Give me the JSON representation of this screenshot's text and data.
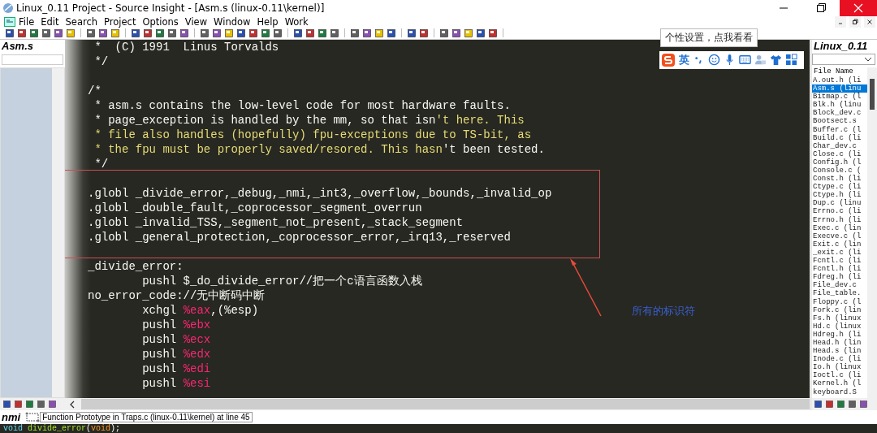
{
  "window": {
    "title": "Linux_0.11 Project - Source Insight - [Asm.s (linux-0.11\\kernel)]"
  },
  "menu": [
    "File",
    "Edit",
    "Search",
    "Project",
    "Options",
    "View",
    "Window",
    "Help",
    "Work"
  ],
  "left_panel": {
    "title": "Asm.s"
  },
  "code": [
    {
      "kind": "code",
      "segments": [
        {
          "kind": "plain",
          "text": " *  (C) 1991  Linus Torvalds"
        }
      ]
    },
    {
      "kind": "code",
      "segments": [
        {
          "kind": "plain",
          "text": " */"
        }
      ]
    },
    {
      "kind": "blank"
    },
    {
      "kind": "code",
      "segments": [
        {
          "kind": "plain",
          "text": "/*"
        }
      ]
    },
    {
      "kind": "code",
      "segments": [
        {
          "kind": "plain",
          "text": " * asm.s contains the low-level code for most hardware faults."
        }
      ]
    },
    {
      "kind": "code",
      "segments": [
        {
          "kind": "plain",
          "text": " * page_exception is handled by the mm, so that isn"
        },
        {
          "kind": "string",
          "text": "'t here. This"
        }
      ]
    },
    {
      "kind": "code",
      "segments": [
        {
          "kind": "string",
          "text": " * file also handles (hopefully) fpu-exceptions due to TS-bit, as"
        }
      ]
    },
    {
      "kind": "code",
      "segments": [
        {
          "kind": "string",
          "text": " * the fpu must be properly saved/resored. This hasn"
        },
        {
          "kind": "plain",
          "text": "'t been tested."
        }
      ]
    },
    {
      "kind": "code",
      "segments": [
        {
          "kind": "plain",
          "text": " */"
        }
      ]
    },
    {
      "kind": "blank"
    },
    {
      "kind": "code",
      "segments": [
        {
          "kind": "plain",
          "text": ".globl _divide_error,_debug,_nmi,_int3,_overflow,_bounds,_invalid_op"
        }
      ]
    },
    {
      "kind": "code",
      "segments": [
        {
          "kind": "plain",
          "text": ".globl _double_fault,_coprocessor_segment_overrun"
        }
      ]
    },
    {
      "kind": "code",
      "segments": [
        {
          "kind": "plain",
          "text": ".globl _invalid_TSS,_segment_not_present,_stack_segment"
        }
      ]
    },
    {
      "kind": "code",
      "segments": [
        {
          "kind": "plain",
          "text": ".globl _general_protection,_coprocessor_error,_irq13,_reserved"
        }
      ]
    },
    {
      "kind": "blank"
    },
    {
      "kind": "code",
      "segments": [
        {
          "kind": "plain",
          "text": "_divide_error:"
        }
      ]
    },
    {
      "kind": "code",
      "segments": [
        {
          "kind": "plain",
          "text": "        pushl $_do_divide_error//把一个c语言函数入栈"
        }
      ]
    },
    {
      "kind": "code",
      "segments": [
        {
          "kind": "plain",
          "text": "no_error_code://无中断码中断"
        }
      ]
    },
    {
      "kind": "code",
      "segments": [
        {
          "kind": "plain",
          "text": "        xchgl "
        },
        {
          "kind": "register",
          "text": "%eax"
        },
        {
          "kind": "plain",
          "text": ",(%esp)"
        }
      ]
    },
    {
      "kind": "code",
      "segments": [
        {
          "kind": "plain",
          "text": "        pushl "
        },
        {
          "kind": "register",
          "text": "%ebx"
        }
      ]
    },
    {
      "kind": "code",
      "segments": [
        {
          "kind": "plain",
          "text": "        pushl "
        },
        {
          "kind": "register",
          "text": "%ecx"
        }
      ]
    },
    {
      "kind": "code",
      "segments": [
        {
          "kind": "plain",
          "text": "        pushl "
        },
        {
          "kind": "register",
          "text": "%edx"
        }
      ]
    },
    {
      "kind": "code",
      "segments": [
        {
          "kind": "plain",
          "text": "        pushl "
        },
        {
          "kind": "register",
          "text": "%edi"
        }
      ]
    },
    {
      "kind": "code",
      "segments": [
        {
          "kind": "plain",
          "text": "        pushl "
        },
        {
          "kind": "register",
          "text": "%esi"
        }
      ]
    }
  ],
  "annotation": {
    "label": "所有的标识符"
  },
  "ime_toolbar": {
    "tooltip": "个性设置，点我看看",
    "mode": "英"
  },
  "right_panel": {
    "title": "Linux_0.11",
    "column": "File Name",
    "files": [
      {
        "name": "A.out.h (li",
        "selected": false
      },
      {
        "name": "Asm.s (linu",
        "selected": true
      },
      {
        "name": "Bitmap.c (l",
        "selected": false
      },
      {
        "name": "Blk.h (linu",
        "selected": false
      },
      {
        "name": "Block_dev.c",
        "selected": false
      },
      {
        "name": "Bootsect.s",
        "selected": false
      },
      {
        "name": "Buffer.c (l",
        "selected": false
      },
      {
        "name": "Build.c (li",
        "selected": false
      },
      {
        "name": "Char_dev.c",
        "selected": false
      },
      {
        "name": "Close.c (li",
        "selected": false
      },
      {
        "name": "Config.h (l",
        "selected": false
      },
      {
        "name": "Console.c (",
        "selected": false
      },
      {
        "name": "Const.h (li",
        "selected": false
      },
      {
        "name": "Ctype.c (li",
        "selected": false
      },
      {
        "name": "Ctype.h (li",
        "selected": false
      },
      {
        "name": "Dup.c (linu",
        "selected": false
      },
      {
        "name": "Errno.c (li",
        "selected": false
      },
      {
        "name": "Errno.h (li",
        "selected": false
      },
      {
        "name": "Exec.c (lin",
        "selected": false
      },
      {
        "name": "Execve.c (l",
        "selected": false
      },
      {
        "name": "Exit.c (lin",
        "selected": false
      },
      {
        "name": "_exit.c (li",
        "selected": false
      },
      {
        "name": "Fcntl.c (li",
        "selected": false
      },
      {
        "name": "Fcntl.h (li",
        "selected": false
      },
      {
        "name": "Fdreg.h (li",
        "selected": false
      },
      {
        "name": "File_dev.c",
        "selected": false
      },
      {
        "name": "File_table.",
        "selected": false
      },
      {
        "name": "Floppy.c (l",
        "selected": false
      },
      {
        "name": "Fork.c (lin",
        "selected": false
      },
      {
        "name": "Fs.h (linux",
        "selected": false
      },
      {
        "name": "Hd.c (linux",
        "selected": false
      },
      {
        "name": "Hdreg.h (li",
        "selected": false
      },
      {
        "name": "Head.h (lin",
        "selected": false
      },
      {
        "name": "Head.s (lin",
        "selected": false
      },
      {
        "name": "Inode.c (li",
        "selected": false
      },
      {
        "name": "Io.h (linux",
        "selected": false
      },
      {
        "name": "Ioctl.c (li",
        "selected": false
      },
      {
        "name": "Kernel.h (l",
        "selected": false
      },
      {
        "name": "keyboard.S",
        "selected": false
      }
    ]
  },
  "status": {
    "symbol": "nmi",
    "info": "Function Prototype in Traps.c (linux-0.11\\kernel) at line 45"
  },
  "context_line": [
    {
      "kind": "keyword",
      "text": "void "
    },
    {
      "kind": "function",
      "text": "divide_error"
    },
    {
      "kind": "plain",
      "text": "("
    },
    {
      "kind": "type",
      "text": "void"
    },
    {
      "kind": "plain",
      "text": ");"
    }
  ]
}
